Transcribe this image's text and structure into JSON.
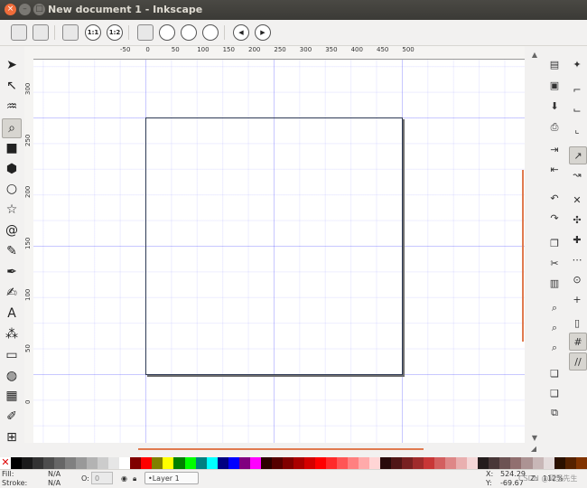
{
  "window": {
    "title": "New document 1 - Inkscape",
    "close": "×",
    "minimize": "–",
    "maximize": "□"
  },
  "commands": [
    {
      "name": "zoom-in-icon",
      "glyph": ""
    },
    {
      "name": "zoom-1-1-icon",
      "glyph": "1:1"
    },
    {
      "name": "zoom-1-2-icon",
      "glyph": "1:2"
    },
    {
      "name": "zoom-selection-icon",
      "glyph": ""
    },
    {
      "name": "zoom-drawing-icon",
      "glyph": ""
    },
    {
      "name": "zoom-page-icon",
      "glyph": ""
    },
    {
      "name": "zoom-page-width-icon",
      "glyph": ""
    },
    {
      "name": "zoom-prev-icon",
      "glyph": "◀"
    },
    {
      "name": "zoom-next-icon",
      "glyph": "▶"
    }
  ],
  "ruler": {
    "top_labels": [
      "-50",
      "0",
      "50",
      "100",
      "150",
      "200",
      "250",
      "300",
      "350",
      "400",
      "450",
      "500"
    ],
    "left_labels": [
      "300",
      "250",
      "200",
      "150",
      "100",
      "50",
      "0"
    ]
  },
  "tools": [
    {
      "name": "selector-tool-icon",
      "glyph": "➤"
    },
    {
      "name": "node-tool-icon",
      "glyph": "↖"
    },
    {
      "name": "tweak-tool-icon",
      "glyph": "♒"
    },
    {
      "name": "zoom-tool-icon",
      "glyph": "⌕"
    },
    {
      "name": "rect-tool-icon",
      "glyph": "■"
    },
    {
      "name": "3dbox-tool-icon",
      "glyph": "⬢"
    },
    {
      "name": "ellipse-tool-icon",
      "glyph": "○"
    },
    {
      "name": "star-tool-icon",
      "glyph": "☆"
    },
    {
      "name": "spiral-tool-icon",
      "glyph": "@"
    },
    {
      "name": "pencil-tool-icon",
      "glyph": "✎"
    },
    {
      "name": "pen-tool-icon",
      "glyph": "✒"
    },
    {
      "name": "calligraphy-tool-icon",
      "glyph": "✍"
    },
    {
      "name": "text-tool-icon",
      "glyph": "A"
    },
    {
      "name": "spray-tool-icon",
      "glyph": "⁂"
    },
    {
      "name": "eraser-tool-icon",
      "glyph": "▭"
    },
    {
      "name": "bucket-tool-icon",
      "glyph": "◍"
    },
    {
      "name": "gradient-tool-icon",
      "glyph": "▦"
    },
    {
      "name": "dropper-tool-icon",
      "glyph": "✐"
    },
    {
      "name": "connector-tool-icon",
      "glyph": "⊞"
    }
  ],
  "right_commands": [
    {
      "name": "new-doc-icon",
      "glyph": "▤"
    },
    {
      "name": "open-icon",
      "glyph": "▣"
    },
    {
      "name": "save-icon",
      "glyph": "⬇"
    },
    {
      "name": "print-icon",
      "glyph": "⎙"
    },
    {
      "name": "import-icon",
      "glyph": "⇥"
    },
    {
      "name": "export-icon",
      "glyph": "⇤"
    },
    {
      "name": "undo-icon",
      "glyph": "↶"
    },
    {
      "name": "redo-icon",
      "glyph": "↷"
    },
    {
      "name": "copy-icon",
      "glyph": "❐"
    },
    {
      "name": "cut-icon",
      "glyph": "✂"
    },
    {
      "name": "paste-icon",
      "glyph": "▥"
    },
    {
      "name": "zoom-cmd-icon",
      "glyph": "⌕"
    },
    {
      "name": "zoom-draw-cmd-icon",
      "glyph": "⌕"
    },
    {
      "name": "zoom-page-cmd-icon",
      "glyph": "⌕"
    },
    {
      "name": "duplicate-icon",
      "glyph": "❏"
    },
    {
      "name": "clone-icon",
      "glyph": "❑"
    },
    {
      "name": "unlink-clone-icon",
      "glyph": "⧉"
    }
  ],
  "snap_controls": [
    {
      "name": "snap-enable-icon",
      "glyph": "✦",
      "on": false
    },
    {
      "name": "snap-bbox-icon",
      "glyph": "⌐",
      "on": false
    },
    {
      "name": "snap-bbox-edge-icon",
      "glyph": "⌙",
      "on": false
    },
    {
      "name": "snap-bbox-corner-icon",
      "glyph": "⌞",
      "on": false
    },
    {
      "name": "snap-nodes-icon",
      "glyph": "↗",
      "on": true
    },
    {
      "name": "snap-path-icon",
      "glyph": "↝",
      "on": false
    },
    {
      "name": "snap-intersection-icon",
      "glyph": "✕",
      "on": false
    },
    {
      "name": "snap-cusp-icon",
      "glyph": "✣",
      "on": false
    },
    {
      "name": "snap-smooth-icon",
      "glyph": "✚",
      "on": false
    },
    {
      "name": "snap-midpoint-icon",
      "glyph": "⋯",
      "on": false
    },
    {
      "name": "snap-center-icon",
      "glyph": "⊙",
      "on": false
    },
    {
      "name": "snap-rotation-icon",
      "glyph": "+",
      "on": false
    },
    {
      "name": "snap-page-icon",
      "glyph": "▯",
      "on": false
    },
    {
      "name": "snap-grid-icon",
      "glyph": "#",
      "on": true
    },
    {
      "name": "snap-guide-icon",
      "glyph": "//",
      "on": true
    }
  ],
  "palette_colors": [
    "#000000",
    "#1a1a1a",
    "#333333",
    "#4d4d4d",
    "#666666",
    "#808080",
    "#999999",
    "#b3b3b3",
    "#cccccc",
    "#e6e6e6",
    "#ffffff",
    "#800000",
    "#ff0000",
    "#808000",
    "#ffff00",
    "#008000",
    "#00ff00",
    "#008080",
    "#00ffff",
    "#000080",
    "#0000ff",
    "#800080",
    "#ff00ff",
    "#2b0000",
    "#550000",
    "#800000",
    "#aa0000",
    "#d40000",
    "#ff0000",
    "#ff2a2a",
    "#ff5555",
    "#ff8080",
    "#ffaaaa",
    "#ffd5d5",
    "#280b0b",
    "#501616",
    "#782121",
    "#a02c2c",
    "#c83737",
    "#d35f5f",
    "#de8787",
    "#e9afaf",
    "#f4d7d7",
    "#241c1c",
    "#483737",
    "#6c5353",
    "#916f6f",
    "#ac9393",
    "#c8b7b7",
    "#e3dbdb",
    "#2b1100",
    "#552200",
    "#803300"
  ],
  "status": {
    "fill_label": "Fill:",
    "fill_value": "N/A",
    "stroke_label": "Stroke:",
    "stroke_value": "N/A",
    "opacity_label": "O:",
    "opacity_value": "0",
    "layer": "•Layer 1",
    "x_label": "X:",
    "x_value": "524.29",
    "y_label": "Y:",
    "y_value": "-69.67",
    "zoom_value": "112%"
  },
  "watermark": "CSDN @阿里先生"
}
